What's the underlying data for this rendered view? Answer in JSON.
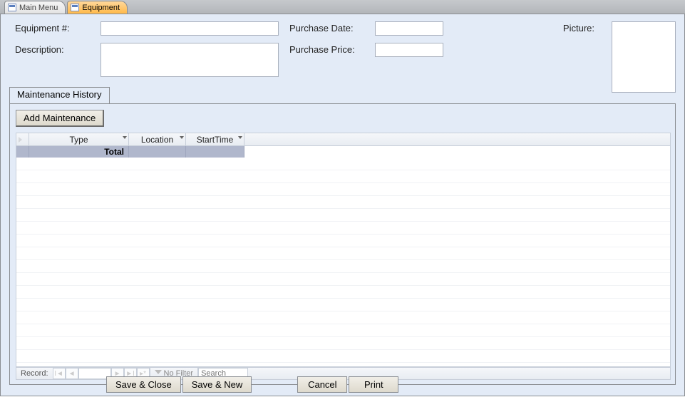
{
  "tabs": {
    "main_menu": "Main Menu",
    "equipment": "Equipment"
  },
  "fields": {
    "equipment_no_label": "Equipment #:",
    "equipment_no_value": "",
    "description_label": "Description:",
    "description_value": "",
    "purchase_date_label": "Purchase Date:",
    "purchase_date_value": "",
    "purchase_price_label": "Purchase Price:",
    "purchase_price_value": "",
    "picture_label": "Picture:"
  },
  "subform": {
    "tab_label": "Maintenance History",
    "add_button": "Add Maintenance",
    "columns": {
      "type": "Type",
      "location": "Location",
      "start": "StartTime"
    },
    "total_label": "Total"
  },
  "record_nav": {
    "label": "Record:",
    "current": "",
    "filter_label": "No Filter",
    "search_placeholder": "Search"
  },
  "buttons": {
    "save_close": "Save & Close",
    "save_new": "Save & New",
    "cancel": "Cancel",
    "print": "Print"
  }
}
